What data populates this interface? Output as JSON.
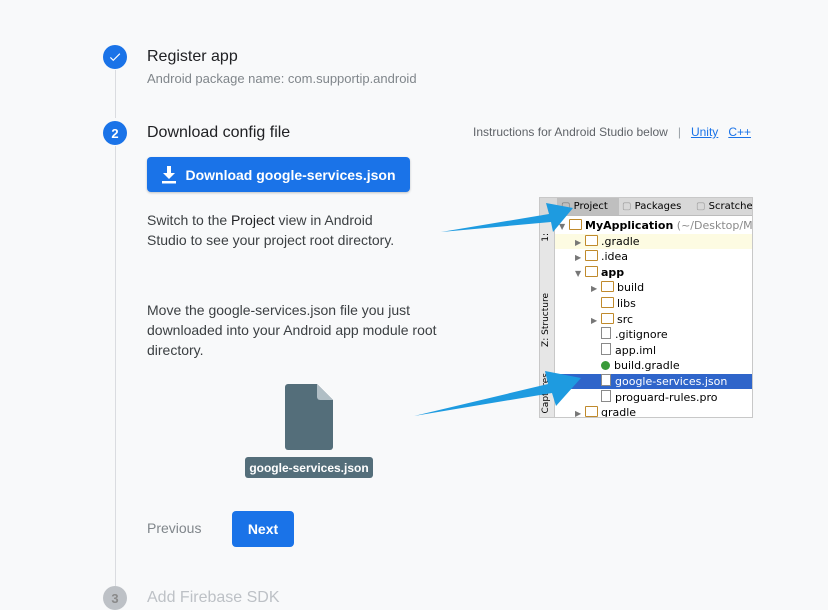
{
  "steps": [
    {
      "title": "Register app",
      "subtitle": "Android package name: com.supportip.android"
    },
    {
      "number": "2",
      "title": "Download config file"
    },
    {
      "number": "3",
      "title": "Add Firebase SDK"
    }
  ],
  "instructions": {
    "text": "Instructions for Android Studio below",
    "separator": "|",
    "unity_link": "Unity",
    "cpp_link": "C++"
  },
  "download_button": {
    "label": "Download google-services.json",
    "icon": "download-icon"
  },
  "para1": {
    "pre": "Switch to the ",
    "bold": "Project",
    "post": " view in Android Studio to see your project root directory."
  },
  "para2": "Move the google-services.json file you just downloaded into your Android app module root directory.",
  "file_label": "google-services.json",
  "nav": {
    "previous": "Previous",
    "next": "Next"
  },
  "ide": {
    "tabs": [
      "Project",
      "Packages",
      "Scratches"
    ],
    "side_labels": [
      "1:",
      "Z: Structure",
      "Captures"
    ],
    "tree": [
      {
        "label": "MyApplication",
        "suffix": "(~/Desktop/My",
        "type": "module",
        "level": 0,
        "expanded": true
      },
      {
        "label": ".gradle",
        "type": "folder",
        "level": 1,
        "expanded": false
      },
      {
        "label": ".idea",
        "type": "folder",
        "level": 1,
        "expanded": false
      },
      {
        "label": "app",
        "type": "module",
        "level": 1,
        "expanded": true
      },
      {
        "label": "build",
        "type": "folder",
        "level": 2,
        "expanded": false
      },
      {
        "label": "libs",
        "type": "folder",
        "level": 2
      },
      {
        "label": "src",
        "type": "folder",
        "level": 2,
        "expanded": false
      },
      {
        "label": ".gitignore",
        "type": "file",
        "level": 2
      },
      {
        "label": "app.iml",
        "type": "file",
        "level": 2
      },
      {
        "label": "build.gradle",
        "type": "gradle",
        "level": 2
      },
      {
        "label": "google-services.json",
        "type": "json",
        "level": 2,
        "selected": true
      },
      {
        "label": "proguard-rules.pro",
        "type": "file",
        "level": 2
      },
      {
        "label": "gradle",
        "type": "folder",
        "level": 1,
        "expanded": false
      }
    ]
  },
  "colors": {
    "primary": "#1a73e8",
    "arrow": "#1e9be0",
    "file_icon": "#546e7a"
  }
}
